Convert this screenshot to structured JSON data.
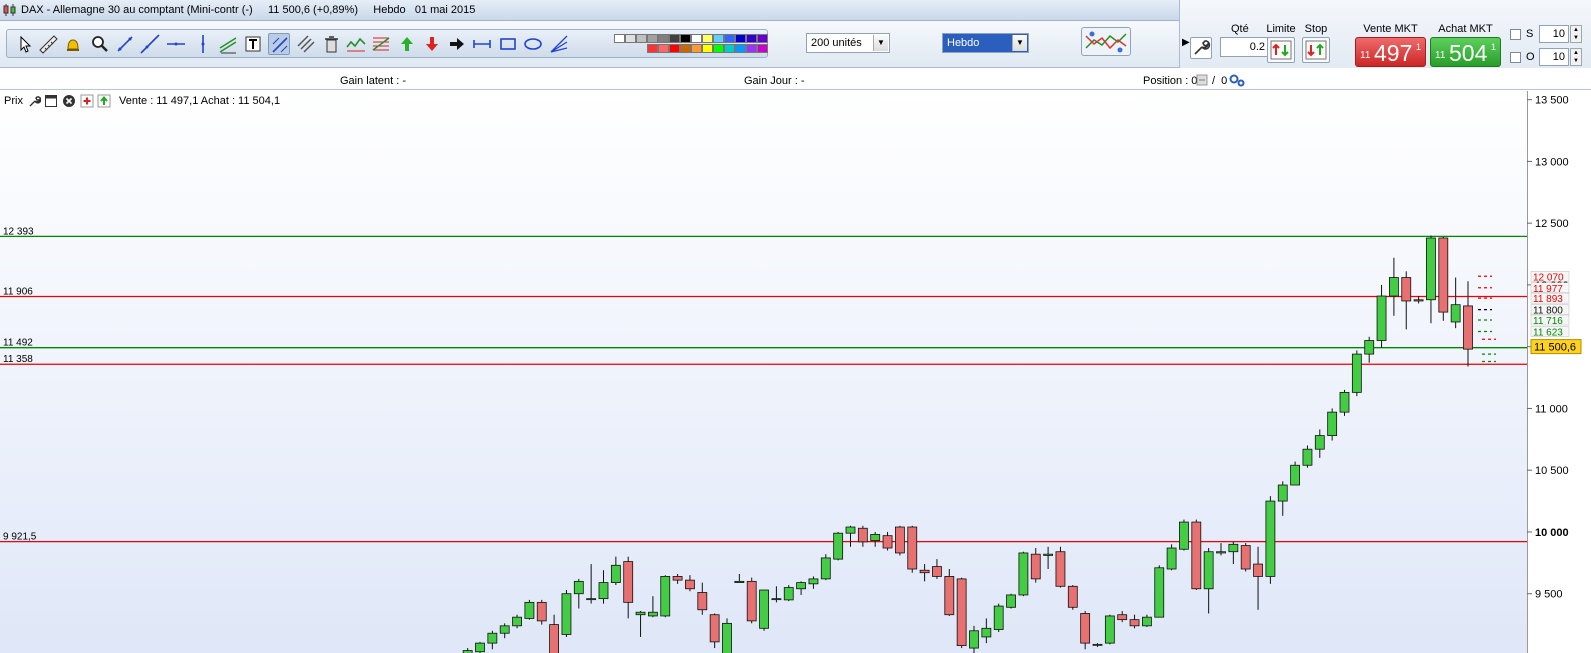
{
  "window": {
    "title": "DAX - Allemagne 30 au comptant (Mini-contr (-)     11 500,6 (+0,89%)     Hebdo   01 mai 2015"
  },
  "toolbar": {
    "units_select": "200 unités",
    "period_select": "Hebdo",
    "tools": [
      "cursor-icon",
      "ruler-icon",
      "alarm-bell-icon",
      "zoom-icon",
      "segment-icon",
      "trendline-icon",
      "horizontal-line-icon",
      "vertical-line-icon",
      "channel-icon",
      "text-icon",
      "draw-icon",
      "pitchfork-icon",
      "trash-icon",
      "wave-icon",
      "fibonacci-icon",
      "buy-arrow-icon",
      "sell-arrow-icon",
      "right-arrow-icon",
      "range-icon",
      "rectangle-icon",
      "ellipse-icon",
      "fan-icon"
    ],
    "palette_colors": [
      "#ffffff",
      "#e0e0e0",
      "#c0c0c0",
      "#a0a0a0",
      "#808080",
      "#404040",
      "#000000",
      "#ffffff",
      "#ffff66",
      "#66ccff",
      "#3366ff",
      "#0000cc",
      "#3300cc",
      "#6600cc",
      "#ff3333",
      "#ff6666",
      "#ff0000",
      "#cc6600",
      "#ff9933",
      "#ffff00",
      "#00ff00",
      "#00cccc",
      "#0099ff",
      "#9933ff",
      "#cc00cc"
    ]
  },
  "order_panel": {
    "qty_label": "Qté",
    "qty_value": "0.2",
    "limit_label": "Limite",
    "stop_label": "Stop",
    "sell_label": "Vente MKT",
    "buy_label": "Achat MKT",
    "sell_price": {
      "prefix": "11",
      "main": "497",
      "sup": "1"
    },
    "buy_price": {
      "prefix": "11",
      "main": "504",
      "sup": "1"
    },
    "s_label": "S",
    "o_label": "O",
    "s_value": "10",
    "o_value": "10"
  },
  "infobar": {
    "gain_latent": "Gain latent : -",
    "gain_jour": "Gain Jour : -",
    "position": "Position : 0",
    "position_sep": "/  0"
  },
  "chart": {
    "header_label": "Prix",
    "quote": "Vente : 11 497,1 Achat : 11 504,1",
    "current_price": "11 500,6",
    "colors": {
      "up": "#44cc44",
      "down": "#e77171",
      "support": "#008800",
      "resistance": "#ee0000",
      "bg_top": "#ffffff",
      "bg_bottom": "#dfe7f8"
    }
  },
  "chart_data": {
    "type": "candlestick",
    "instrument": "DAX - Allemagne 30 au comptant (Mini-contr (-)",
    "period": "Hebdo",
    "y_ticks": [
      9500,
      10000,
      10500,
      11000,
      11500,
      12000,
      12500,
      13000,
      13500
    ],
    "y_tick_labels": [
      "9 500",
      "10 000",
      "10 500",
      "11 000",
      "11 500",
      "12 000",
      "12 500",
      "13 000",
      "13 500"
    ],
    "ylim": [
      9020,
      13570
    ],
    "horizontal_lines": [
      {
        "value": 12393,
        "label": "12 393",
        "color": "#008800"
      },
      {
        "value": 11906,
        "label": "11 906",
        "color": "#ee0000"
      },
      {
        "value": 11492,
        "label": "11 492",
        "color": "#008800"
      },
      {
        "value": 11358,
        "label": "11 358",
        "color": "#ee0000"
      },
      {
        "value": 9921.5,
        "label": "9 921,5",
        "color": "#ee0000"
      }
    ],
    "order_levels": [
      {
        "value": 12070,
        "label": "12 070",
        "color": "#ee0000"
      },
      {
        "value": 11977,
        "label": "11 977",
        "color": "#ee0000"
      },
      {
        "value": 11893,
        "label": "11 893",
        "color": "#ee0000"
      },
      {
        "value": 11800,
        "label": "11 800",
        "color": "#000000"
      },
      {
        "value": 11716,
        "label": "11 716",
        "color": "#008800"
      },
      {
        "value": 11623,
        "label": "11 623",
        "color": "#008800"
      }
    ],
    "candles": [
      {
        "o": 8960,
        "h": 9060,
        "l": 8900,
        "c": 9040
      },
      {
        "o": 9030,
        "h": 9110,
        "l": 8960,
        "c": 9100
      },
      {
        "o": 9100,
        "h": 9200,
        "l": 9050,
        "c": 9180
      },
      {
        "o": 9180,
        "h": 9260,
        "l": 9140,
        "c": 9240
      },
      {
        "o": 9240,
        "h": 9330,
        "l": 9220,
        "c": 9310
      },
      {
        "o": 9300,
        "h": 9450,
        "l": 9290,
        "c": 9430
      },
      {
        "o": 9430,
        "h": 9450,
        "l": 9250,
        "c": 9280
      },
      {
        "o": 9250,
        "h": 9330,
        "l": 8900,
        "c": 8950
      },
      {
        "o": 9170,
        "h": 9530,
        "l": 9150,
        "c": 9500
      },
      {
        "o": 9500,
        "h": 9620,
        "l": 9380,
        "c": 9600
      },
      {
        "o": 9460,
        "h": 9740,
        "l": 9420,
        "c": 9460
      },
      {
        "o": 9460,
        "h": 9690,
        "l": 9420,
        "c": 9590
      },
      {
        "o": 9590,
        "h": 9800,
        "l": 9570,
        "c": 9730
      },
      {
        "o": 9760,
        "h": 9800,
        "l": 9300,
        "c": 9430
      },
      {
        "o": 9330,
        "h": 9360,
        "l": 9150,
        "c": 9350
      },
      {
        "o": 9320,
        "h": 9480,
        "l": 9310,
        "c": 9350
      },
      {
        "o": 9320,
        "h": 9650,
        "l": 9310,
        "c": 9640
      },
      {
        "o": 9640,
        "h": 9660,
        "l": 9580,
        "c": 9610
      },
      {
        "o": 9610,
        "h": 9650,
        "l": 9520,
        "c": 9540
      },
      {
        "o": 9510,
        "h": 9590,
        "l": 9330,
        "c": 9370
      },
      {
        "o": 9330,
        "h": 9340,
        "l": 9060,
        "c": 9110
      },
      {
        "o": 9010,
        "h": 9300,
        "l": 8980,
        "c": 9260
      },
      {
        "o": 9590,
        "h": 9660,
        "l": 9590,
        "c": 9600
      },
      {
        "o": 9600,
        "h": 9630,
        "l": 9260,
        "c": 9280
      },
      {
        "o": 9220,
        "h": 9530,
        "l": 9200,
        "c": 9530
      },
      {
        "o": 9460,
        "h": 9560,
        "l": 9430,
        "c": 9460
      },
      {
        "o": 9450,
        "h": 9570,
        "l": 9440,
        "c": 9550
      },
      {
        "o": 9540,
        "h": 9600,
        "l": 9490,
        "c": 9590
      },
      {
        "o": 9580,
        "h": 9640,
        "l": 9540,
        "c": 9620
      },
      {
        "o": 9620,
        "h": 9820,
        "l": 9610,
        "c": 9790
      },
      {
        "o": 9780,
        "h": 10000,
        "l": 9770,
        "c": 9990
      },
      {
        "o": 9990,
        "h": 10050,
        "l": 9880,
        "c": 10040
      },
      {
        "o": 10030,
        "h": 10050,
        "l": 9880,
        "c": 9920
      },
      {
        "o": 9930,
        "h": 10000,
        "l": 9880,
        "c": 9980
      },
      {
        "o": 9970,
        "h": 10000,
        "l": 9850,
        "c": 9870
      },
      {
        "o": 10040,
        "h": 10050,
        "l": 9810,
        "c": 9830
      },
      {
        "o": 10040,
        "h": 10050,
        "l": 9670,
        "c": 9700
      },
      {
        "o": 9690,
        "h": 9740,
        "l": 9600,
        "c": 9670
      },
      {
        "o": 9720,
        "h": 9780,
        "l": 9620,
        "c": 9640
      },
      {
        "o": 9640,
        "h": 9700,
        "l": 9320,
        "c": 9330
      },
      {
        "o": 9620,
        "h": 9630,
        "l": 9060,
        "c": 9080
      },
      {
        "o": 9060,
        "h": 9240,
        "l": 9000,
        "c": 9200
      },
      {
        "o": 9150,
        "h": 9300,
        "l": 9100,
        "c": 9220
      },
      {
        "o": 9210,
        "h": 9420,
        "l": 9190,
        "c": 9400
      },
      {
        "o": 9390,
        "h": 9500,
        "l": 9380,
        "c": 9490
      },
      {
        "o": 9490,
        "h": 9840,
        "l": 9480,
        "c": 9830
      },
      {
        "o": 9820,
        "h": 9870,
        "l": 9590,
        "c": 9620
      },
      {
        "o": 9810,
        "h": 9880,
        "l": 9700,
        "c": 9820
      },
      {
        "o": 9840,
        "h": 9880,
        "l": 9550,
        "c": 9560
      },
      {
        "o": 9560,
        "h": 9570,
        "l": 9370,
        "c": 9390
      },
      {
        "o": 9340,
        "h": 9360,
        "l": 9050,
        "c": 9100
      },
      {
        "o": 9090,
        "h": 9100,
        "l": 9070,
        "c": 9090
      },
      {
        "o": 9100,
        "h": 9330,
        "l": 9090,
        "c": 9320
      },
      {
        "o": 9330,
        "h": 9360,
        "l": 9270,
        "c": 9290
      },
      {
        "o": 9290,
        "h": 9330,
        "l": 9220,
        "c": 9240
      },
      {
        "o": 9240,
        "h": 9330,
        "l": 9230,
        "c": 9310
      },
      {
        "o": 9310,
        "h": 9730,
        "l": 9310,
        "c": 9710
      },
      {
        "o": 9700,
        "h": 9900,
        "l": 9690,
        "c": 9870
      },
      {
        "o": 9860,
        "h": 10100,
        "l": 9850,
        "c": 10080
      },
      {
        "o": 10080,
        "h": 10100,
        "l": 9530,
        "c": 9540
      },
      {
        "o": 9540,
        "h": 9870,
        "l": 9340,
        "c": 9840
      },
      {
        "o": 9830,
        "h": 9910,
        "l": 9810,
        "c": 9840
      },
      {
        "o": 9840,
        "h": 9920,
        "l": 9740,
        "c": 9900
      },
      {
        "o": 9890,
        "h": 9910,
        "l": 9680,
        "c": 9700
      },
      {
        "o": 9740,
        "h": 9880,
        "l": 9370,
        "c": 9640
      },
      {
        "o": 9640,
        "h": 10290,
        "l": 9580,
        "c": 10250
      },
      {
        "o": 10250,
        "h": 10410,
        "l": 10130,
        "c": 10380
      },
      {
        "o": 10380,
        "h": 10570,
        "l": 10380,
        "c": 10540
      },
      {
        "o": 10540,
        "h": 10700,
        "l": 10520,
        "c": 10670
      },
      {
        "o": 10670,
        "h": 10830,
        "l": 10600,
        "c": 10780
      },
      {
        "o": 10780,
        "h": 11000,
        "l": 10740,
        "c": 10970
      },
      {
        "o": 10970,
        "h": 11150,
        "l": 10940,
        "c": 11130
      },
      {
        "o": 11130,
        "h": 11470,
        "l": 11100,
        "c": 11440
      },
      {
        "o": 11440,
        "h": 11580,
        "l": 11370,
        "c": 11550
      },
      {
        "o": 11550,
        "h": 12000,
        "l": 11490,
        "c": 11910
      },
      {
        "o": 11910,
        "h": 12220,
        "l": 11750,
        "c": 12060
      },
      {
        "o": 12060,
        "h": 12110,
        "l": 11640,
        "c": 11870
      },
      {
        "o": 11880,
        "h": 11910,
        "l": 11850,
        "c": 11870
      },
      {
        "o": 11880,
        "h": 12400,
        "l": 11690,
        "c": 12380
      },
      {
        "o": 12380,
        "h": 12390,
        "l": 11710,
        "c": 11780
      },
      {
        "o": 11700,
        "h": 12060,
        "l": 11650,
        "c": 11840
      },
      {
        "o": 11830,
        "h": 12030,
        "l": 11340,
        "c": 11480
      }
    ]
  }
}
